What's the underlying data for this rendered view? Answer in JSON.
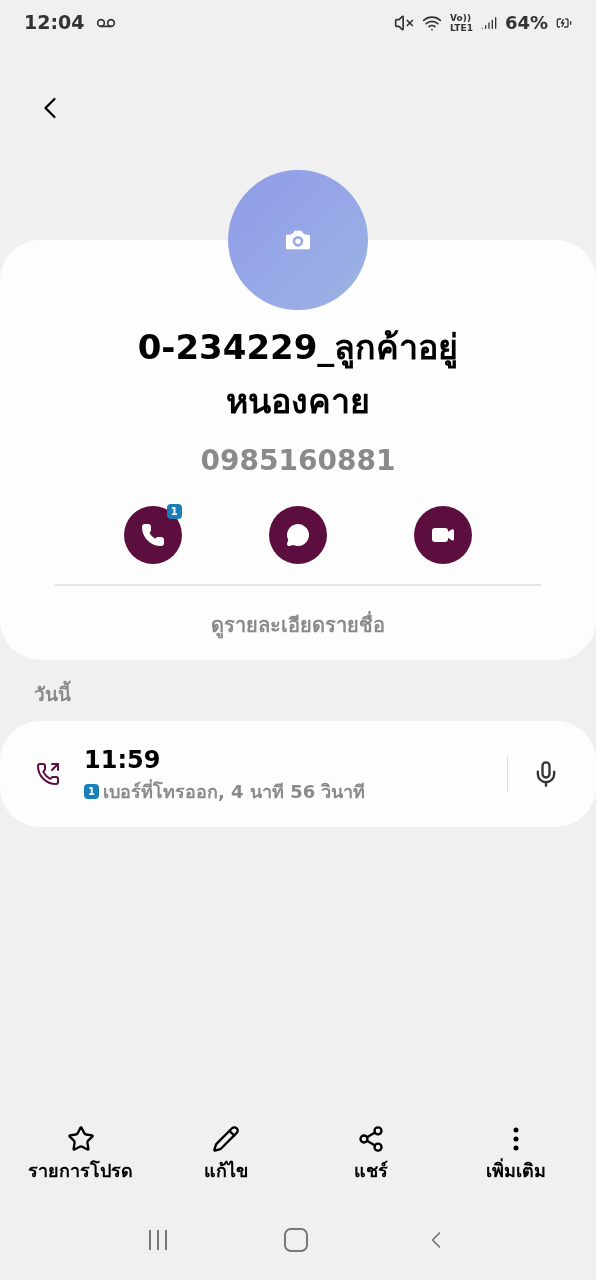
{
  "status_bar": {
    "time": "12:04",
    "volte": "Vo))",
    "network": "LTE1",
    "battery": "64%"
  },
  "contact": {
    "name": "0-234229_ลูกค้าอยู่หนองคาย",
    "number": "0985160881",
    "details_link": "ดูรายละเอียดรายชื่อ"
  },
  "actions": [
    {
      "kind": "call",
      "badge": "1"
    },
    {
      "kind": "message"
    },
    {
      "kind": "video"
    }
  ],
  "history": {
    "heading": "วันนี้",
    "entries": [
      {
        "time": "11:59",
        "sim": "1",
        "description": "เบอร์ที่โทรออก, 4 นาที 56 วินาที"
      }
    ]
  },
  "bottom_bar": [
    {
      "kind": "favorite",
      "label": "รายการโปรด"
    },
    {
      "kind": "edit",
      "label": "แก้ไข"
    },
    {
      "kind": "share",
      "label": "แชร์"
    },
    {
      "kind": "more",
      "label": "เพิ่มเติม"
    }
  ]
}
